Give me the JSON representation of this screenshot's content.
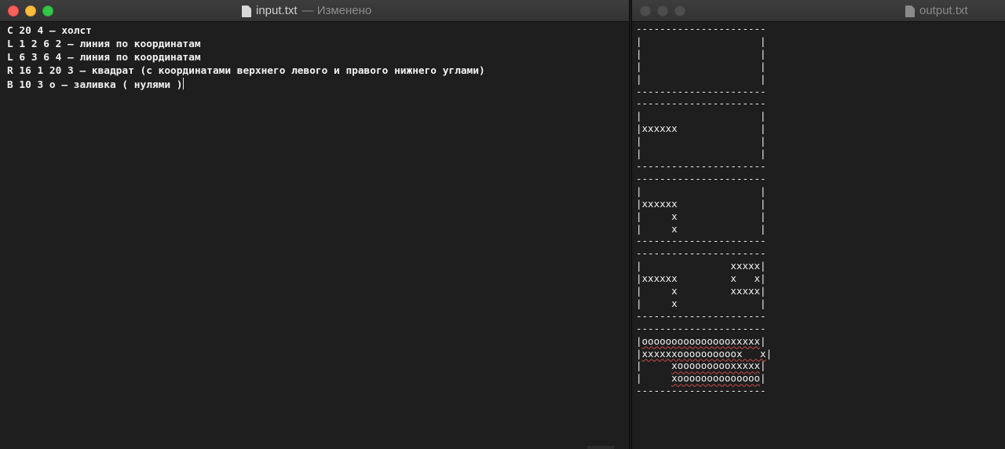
{
  "left_window": {
    "filename": "input.txt",
    "status": "— Изменено",
    "lines": [
      "C 20 4 – холст",
      "L 1 2 6 2 – линия по координатам",
      "L 6 3 6 4 – линия по координатам",
      "R 16 1 20 3 – квадрат (с координатами верхнего левого и правого нижнего углами)",
      "B 10 3 o – заливка ( нулями )"
    ]
  },
  "right_window": {
    "filename": "output.txt",
    "lines": [
      "----------------------",
      "|                    |",
      "|                    |",
      "|                    |",
      "|                    |",
      "----------------------",
      "----------------------",
      "|                    |",
      "|xxxxxx              |",
      "|                    |",
      "|                    |",
      "----------------------",
      "----------------------",
      "|                    |",
      "|xxxxxx              |",
      "|     x              |",
      "|     x              |",
      "----------------------",
      "----------------------",
      "|               xxxxx|",
      "|xxxxxx         x   x|",
      "|     x         xxxxx|",
      "|     x              |",
      "----------------------",
      "----------------------",
      "|oooooooooooooooxxxxx|",
      "|xxxxxxoooooooooox   x|",
      "|     xoooooooooxxxxx|",
      "|     xoooooooooooooo|",
      "----------------------"
    ]
  }
}
